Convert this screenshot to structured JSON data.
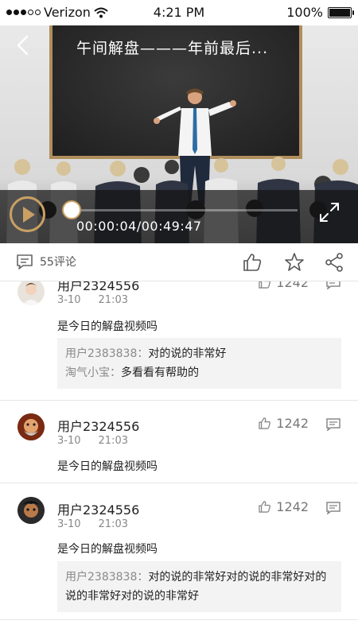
{
  "status_bar": {
    "carrier": "Verizon",
    "time": "4:21 PM",
    "battery": "100%",
    "signal_dots": 5,
    "signal_filled": 3
  },
  "video": {
    "title": "午间解盘———年前最后...",
    "elapsed_time": "00:00:04",
    "total_time": "00:49:47",
    "time_display": "00:00:04/00:49:47",
    "progress_fraction": 0.02,
    "accent": "#c9a063"
  },
  "action_bar": {
    "comment_count_label": "55评论"
  },
  "comments": [
    {
      "user": "用户2324556",
      "date": "3-10",
      "time": "21:03",
      "likes": "1242",
      "text": "是今日的解盘视频吗",
      "replies": [
        {
          "name": "用户2383838",
          "text": "对的说的非常好"
        },
        {
          "name": "淘气小宝",
          "text": "多看看有帮助的"
        }
      ]
    },
    {
      "user": "用户2324556",
      "date": "3-10",
      "time": "21:03",
      "likes": "1242",
      "text": "是今日的解盘视频吗",
      "replies": []
    },
    {
      "user": "用户2324556",
      "date": "3-10",
      "time": "21:03",
      "likes": "1242",
      "text": "是今日的解盘视频吗",
      "replies": [
        {
          "name": "用户2383838",
          "text": "对的说的非常好对的说的非常好对的说的非常好对的说的非常好"
        }
      ]
    }
  ]
}
